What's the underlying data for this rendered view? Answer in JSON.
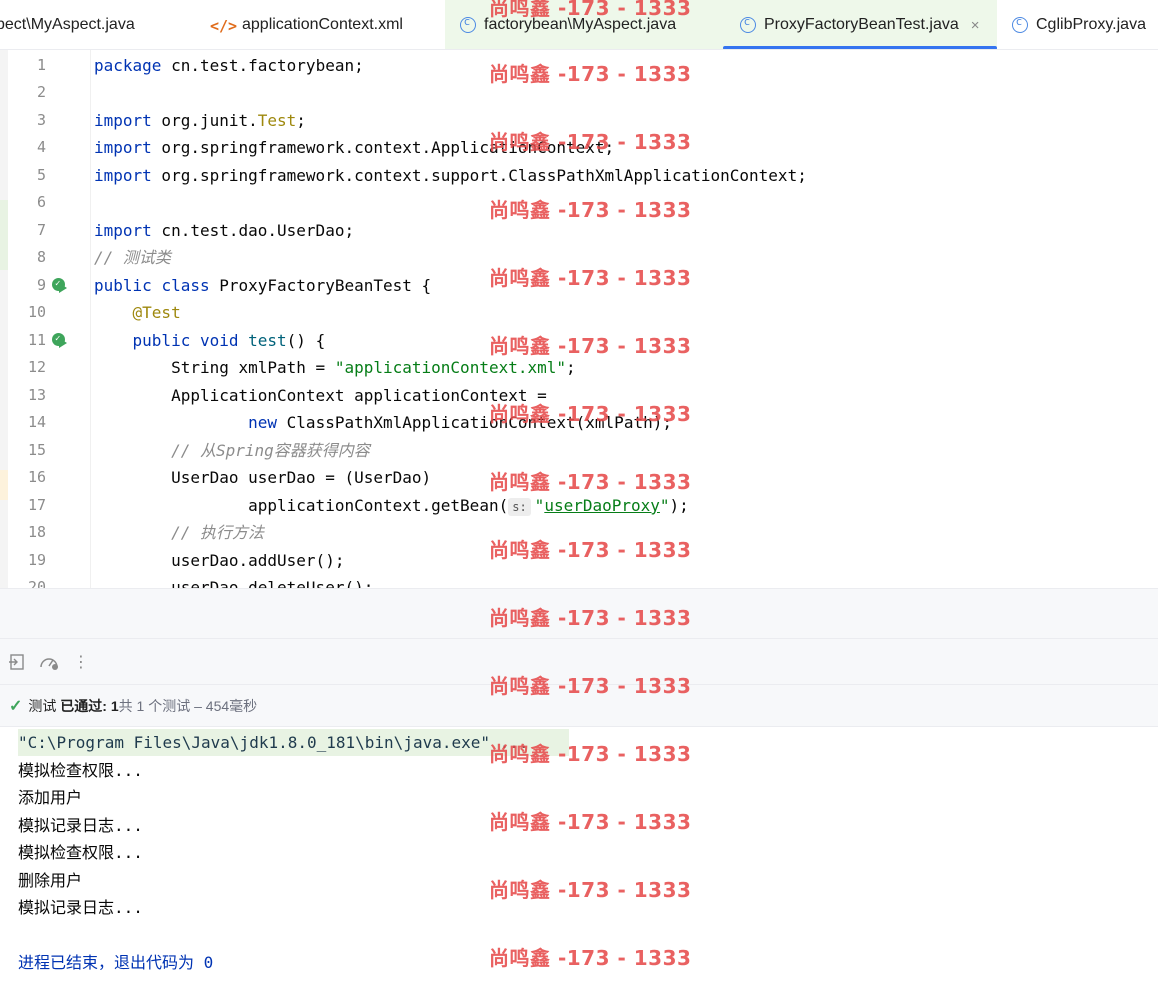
{
  "tabs": [
    {
      "label": "spect\\MyAspect.java",
      "icon": "class-icon"
    },
    {
      "label": "applicationContext.xml",
      "icon": "xml-icon"
    },
    {
      "label": "factorybean\\MyAspect.java",
      "icon": "class-icon"
    },
    {
      "label": "ProxyFactoryBeanTest.java",
      "icon": "test-class-icon",
      "active": true,
      "close": "×"
    },
    {
      "label": "CglibProxy.java",
      "icon": "class-icon"
    }
  ],
  "editor": {
    "line_numbers": [
      "1",
      "2",
      "3",
      "4",
      "5",
      "6",
      "7",
      "8",
      "9",
      "10",
      "11",
      "12",
      "13",
      "14",
      "15",
      "16",
      "17",
      "18",
      "19",
      "20"
    ],
    "l1_kw": "package",
    "l1_rest": " cn.test.factorybean;",
    "l3_kw": "import",
    "l3_rest": " org.junit.",
    "l3_ann": "Test",
    "l3_end": ";",
    "l4_kw": "import",
    "l4_rest": " org.springframework.context.ApplicationContext;",
    "l5_kw": "import",
    "l5_rest": " org.springframework.context.support.ClassPathXmlApplicationContext;",
    "l7_kw": "import",
    "l7_rest": " cn.test.dao.UserDao;",
    "l8_cmt": "// 测试类",
    "l9_kw1": "public",
    "l9_kw2": "class",
    "l9_rest": " ProxyFactoryBeanTest {",
    "l10_ann": "@Test",
    "l11_kw1": "public",
    "l11_kw2": "void",
    "l11_fn": "test",
    "l11_rest": "() {",
    "l12_a": "String xmlPath = ",
    "l12_str": "\"applicationContext.xml\"",
    "l12_end": ";",
    "l13": "ApplicationContext applicationContext =",
    "l14_kw": "new",
    "l14_rest": " ClassPathXmlApplicationContext(xmlPath);",
    "l15_cmt": "// 从Spring容器获得内容",
    "l16": "UserDao userDao = (UserDao)",
    "l17_a": "applicationContext.getBean(",
    "l17_hint": "s:",
    "l17_q1": "\"",
    "l17_str": "userDaoProxy",
    "l17_q2": "\"",
    "l17_end": ");",
    "l18_cmt": "// 执行方法",
    "l19": "userDao.addUser();",
    "l20": "userDao.deleteUser();"
  },
  "toolbar": {
    "icons": [
      "import-tests-icon",
      "coverage-gauge-icon",
      "more-options-icon"
    ]
  },
  "status": {
    "test_label": "测试",
    "passed_label": "已通过:",
    "passed_count": "1",
    "summary": "共 1 个测试 – 454毫秒"
  },
  "console": {
    "lines": [
      "\"C:\\Program Files\\Java\\jdk1.8.0_181\\bin\\java.exe\" ...",
      "模拟检查权限...",
      "添加用户",
      "模拟记录日志...",
      "模拟检查权限...",
      "删除用户",
      "模拟记录日志...",
      "",
      "进程已结束，退出代码为 0"
    ]
  },
  "watermark": "尚鸣鑫 -173 - 1333",
  "colors": {
    "keyword": "#0033b3",
    "string": "#067d17",
    "annotation": "#9e880d",
    "comment": "#8c8c8c",
    "accent": "#3574f0",
    "watermark": "#e74c4c",
    "success": "#3ea55b"
  }
}
